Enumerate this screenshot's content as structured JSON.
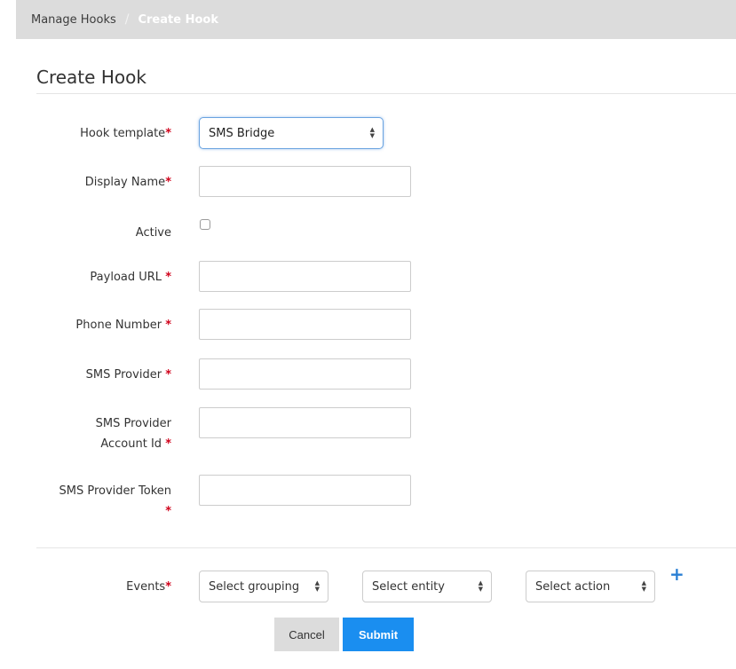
{
  "breadcrumb": {
    "items": [
      {
        "label": "Manage Hooks"
      },
      {
        "label": "Create Hook"
      }
    ],
    "separator": "/"
  },
  "page": {
    "title": "Create Hook"
  },
  "form": {
    "required_marker": "*",
    "hook_template": {
      "label": "Hook template",
      "value": "SMS Bridge"
    },
    "display_name": {
      "label": "Display Name",
      "value": ""
    },
    "active": {
      "label": "Active",
      "checked": false
    },
    "payload_url": {
      "label": "Payload URL",
      "value": ""
    },
    "phone_number": {
      "label": "Phone Number",
      "value": ""
    },
    "sms_provider": {
      "label": "SMS Provider",
      "value": ""
    },
    "sms_provider_account_id": {
      "label_line1": "SMS Provider",
      "label_line2": "Account Id",
      "value": ""
    },
    "sms_provider_token": {
      "label": "SMS Provider Token",
      "value": ""
    },
    "events": {
      "label": "Events",
      "grouping": "Select grouping",
      "entity": "Select entity",
      "action": "Select action"
    }
  },
  "actions": {
    "cancel_label": "Cancel",
    "submit_label": "Submit"
  },
  "icons": {
    "add": "plus-icon",
    "select_arrows": "up-down-arrows-icon"
  },
  "colors": {
    "required": "#d0021b",
    "primary": "#1a8ef0",
    "breadcrumb_bg": "#dcdcdc"
  }
}
